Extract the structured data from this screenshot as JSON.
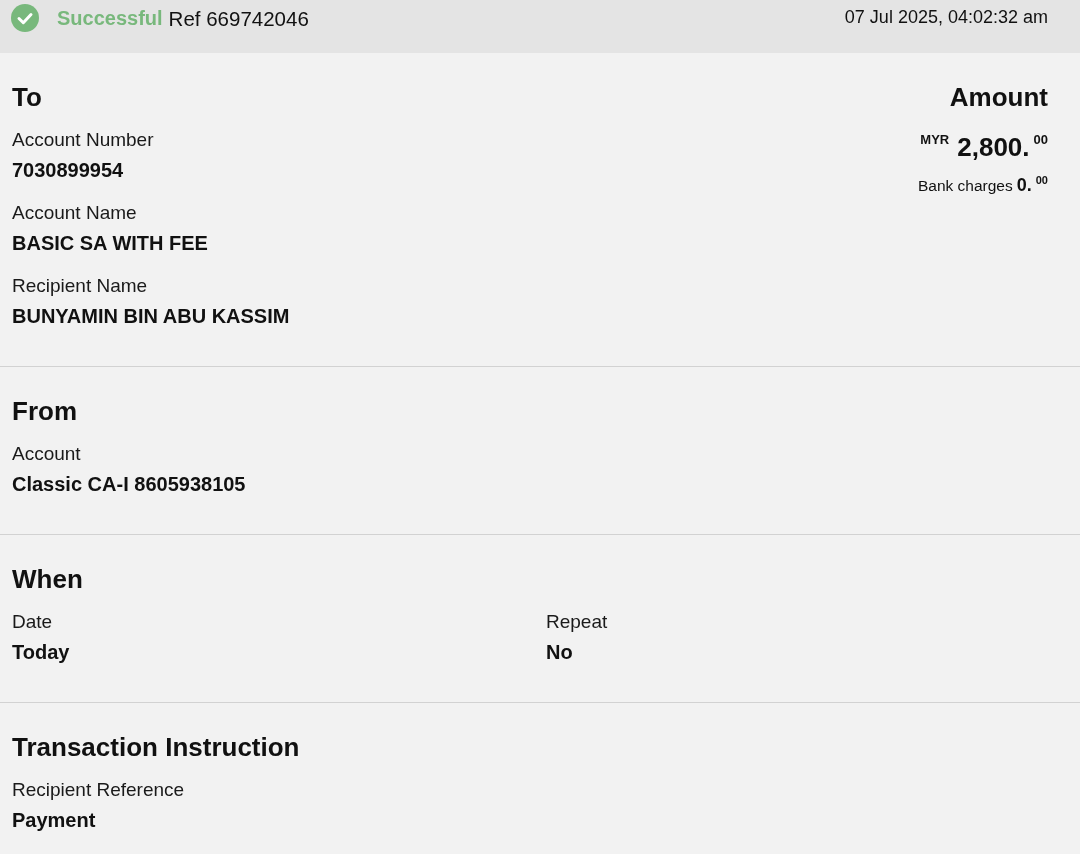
{
  "header": {
    "status": {
      "label": "Successful",
      "kind": "success"
    },
    "reference": "Ref 669742046",
    "timestamp": "07 Jul 2025, 04:02:32 am"
  },
  "sections": [
    {
      "title": "To",
      "kind": "stack",
      "fields": [
        {
          "label": "Account Number",
          "value": "7030899954"
        },
        {
          "label": "Account Name",
          "value": "BASIC SA WITH FEE"
        },
        {
          "label": "Recipient Name",
          "value": "BUNYAMIN BIN ABU KASSIM"
        }
      ],
      "amount": {
        "title": "Amount",
        "currency": "MYR",
        "value": "2,800.$^{00}$",
        "charges_label": "Bank charges",
        "charges_value": "0.$^{00}$"
      }
    },
    {
      "title": "From",
      "kind": "stack",
      "fields": [
        {
          "label": "Account",
          "value": "Classic CA-I 8605938105"
        }
      ]
    },
    {
      "title": "When",
      "kind": "grid",
      "fields": [
        {
          "label": "Date",
          "value": "Today"
        },
        {
          "label": "Repeat",
          "value": "No"
        }
      ]
    },
    {
      "title": "Transaction Instruction",
      "kind": "stack",
      "fields": [
        {
          "label": "Recipient Reference",
          "value": "Payment"
        }
      ]
    }
  ]
}
